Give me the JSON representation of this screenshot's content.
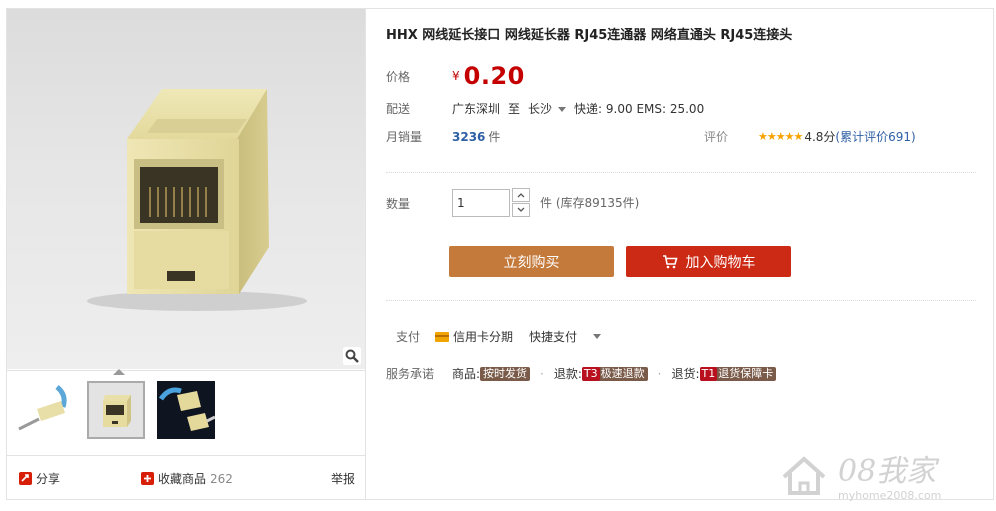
{
  "product": {
    "title": "HHX 网线延长接口 网线延长器 RJ45连通器 网络直通头 RJ45连接头"
  },
  "price": {
    "label": "价格",
    "currency": "¥",
    "value": "0.20"
  },
  "shipping": {
    "label": "配送",
    "from": "广东深圳",
    "to_word": "至",
    "to": "长沙",
    "fees": "快递: 9.00 EMS: 25.00"
  },
  "sales": {
    "label": "月销量",
    "count": "3236",
    "unit": "件"
  },
  "rating": {
    "label": "评价",
    "stars": "★★★★★",
    "score": "4.8分",
    "review_link": "(累计评价691)"
  },
  "quantity": {
    "label": "数量",
    "value": "1",
    "unit_stock": "件 (库存89135件)"
  },
  "buttons": {
    "buy_now": "立刻购买",
    "add_to_cart": "加入购物车"
  },
  "payment": {
    "label": "支付",
    "credit": "信用卡分期",
    "quick": "快捷支付"
  },
  "service": {
    "label": "服务承诺",
    "goods_prefix": "商品:",
    "goods_badge": "按时发货",
    "refund_prefix": "退款:",
    "refund_badge": "T3极速退款",
    "return_prefix": "退货:",
    "return_badge": "T1退货保障卡"
  },
  "gallery": {
    "share": "分享",
    "favorite": "收藏商品",
    "favorite_count": "262",
    "report": "举报"
  },
  "watermark": {
    "brand": "08我家",
    "url": "myhome2008.com"
  },
  "colors": {
    "price_red": "#c40000",
    "buy_orange": "#c47a3b",
    "cart_red": "#cc2a14",
    "link_blue": "#2f5fa5",
    "star_orange": "#f8a400"
  }
}
